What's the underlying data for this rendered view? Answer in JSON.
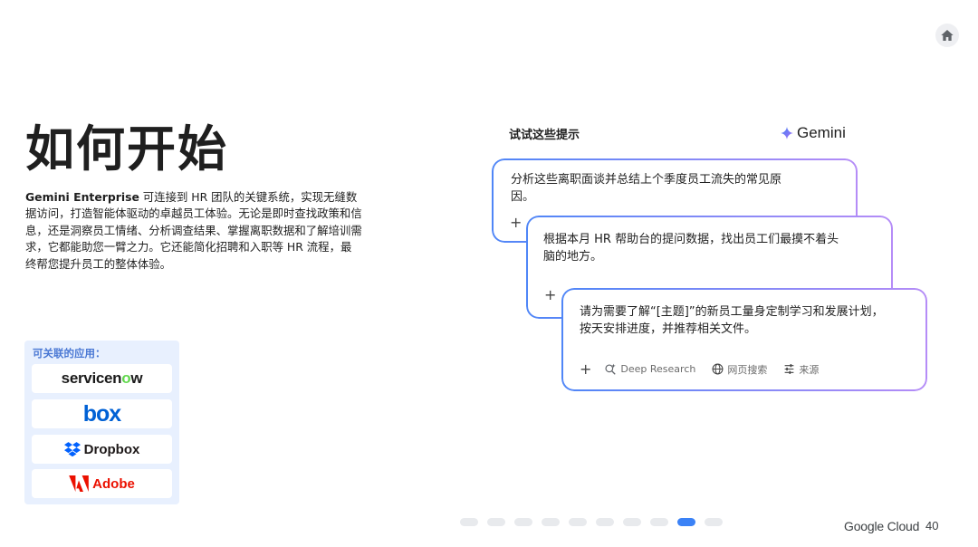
{
  "slide": {
    "title": "如何开始",
    "description_brand": "Gemini Enterprise",
    "description_rest": " 可连接到 HR 团队的关键系统，实现无缝数据访问，打造智能体驱动的卓越员工体验。无论是即时查找政策和信息，还是洞察员工情绪、分析调查结果、掌握离职数据和了解培训需求，它都能助您一臂之力。它还能简化招聘和入职等 HR 流程，最终帮您提升员工的整体体验。"
  },
  "apps": {
    "label": "可关联的应用：",
    "items": [
      {
        "name": "servicenow",
        "text_a": "servicen",
        "text_o": "o",
        "text_b": "w"
      },
      {
        "name": "box",
        "text": "box"
      },
      {
        "name": "Dropbox",
        "text": "Dropbox"
      },
      {
        "name": "Adobe",
        "text": "Adobe"
      }
    ]
  },
  "prompts": {
    "label": "试试这些提示",
    "brand": "Gemini",
    "cards": [
      {
        "text": "分析这些离职面谈并总结上个季度员工流失的常见原因。",
        "plus": "+"
      },
      {
        "text": "根据本月 HR 帮助台的提问数据，找出员工们最摸不着头脑的地方。",
        "plus": "+"
      },
      {
        "text": "请为需要了解“[主题]”的新员工量身定制学习和发展计划，按天安排进度，并推荐相关文件。",
        "plus": "+"
      }
    ],
    "toolbar": {
      "deep_research": "Deep Research",
      "web_search": "网页搜索",
      "sources": "来源"
    }
  },
  "pager": {
    "total": 10,
    "active_index": 8
  },
  "footer": {
    "logo": "Google Cloud",
    "page_number": "40"
  },
  "colors": {
    "accent_blue": "#3b82f6",
    "card_gradient_start": "#4f86f7",
    "card_gradient_end": "#b58cf7",
    "apps_panel_bg": "#e8f0fe"
  }
}
